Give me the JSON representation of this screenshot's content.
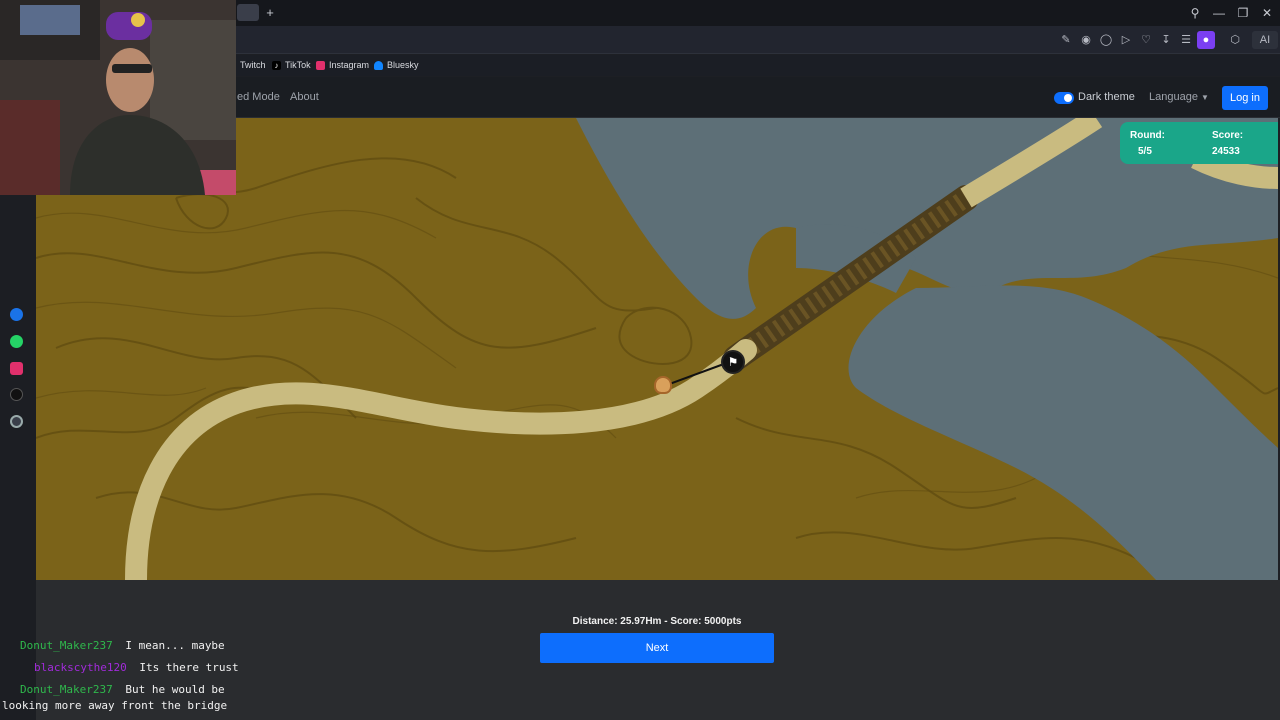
{
  "browser": {
    "new_tab_label": "+",
    "window_controls": [
      "search-icon",
      "minimize-icon",
      "restore-icon",
      "close-icon"
    ],
    "toolbar_icons": [
      "edit-icon",
      "camera-icon",
      "shield-icon",
      "play-icon",
      "heart-icon",
      "download-icon",
      "menu-icon",
      "extension-icon",
      "cube-icon"
    ],
    "ai_label": "AI"
  },
  "bookmarks": [
    {
      "label": "Twitch",
      "icon": "twitch-icon",
      "color": "#9146ff"
    },
    {
      "label": "TikTok",
      "icon": "tiktok-icon",
      "color": "#111111"
    },
    {
      "label": "Instagram",
      "icon": "instagram-icon",
      "color": "#e1306c"
    },
    {
      "label": "Bluesky",
      "icon": "bluesky-icon",
      "color": "#1185fe"
    }
  ],
  "nav": {
    "links": [
      "ed Mode",
      "About"
    ],
    "dark_theme_label": "Dark theme",
    "dark_theme_on": true,
    "language_label": "Language",
    "login_label": "Log in"
  },
  "game": {
    "round_label": "Round:",
    "round_value": "5/5",
    "score_label": "Score:",
    "score_value": "24533",
    "result_text": "Distance: 25.97Hm - Score: 5000pts",
    "next_label": "Next"
  },
  "side_icons": [
    "messenger-icon",
    "whatsapp-icon",
    "instagram-icon",
    "tiktok-icon",
    "threads-icon"
  ],
  "chat": [
    {
      "user": "Donut_Maker237",
      "user_color": "#2fb84c",
      "message": "I mean... maybe"
    },
    {
      "user": "blackscythe120",
      "user_color": "#a12bd9",
      "message": "Its there trust"
    },
    {
      "user": "Donut_Maker237",
      "user_color": "#2fb84c",
      "message": "But he would be"
    },
    {
      "user": "",
      "user_color": "#2fb84c",
      "message": "looking more away front the bridge"
    }
  ],
  "colors": {
    "accent": "#0d6efd",
    "score_panel": "#1aa689",
    "map_land": "#7b6319",
    "map_water": "#5d6f77",
    "map_road": "#c9bb80"
  }
}
